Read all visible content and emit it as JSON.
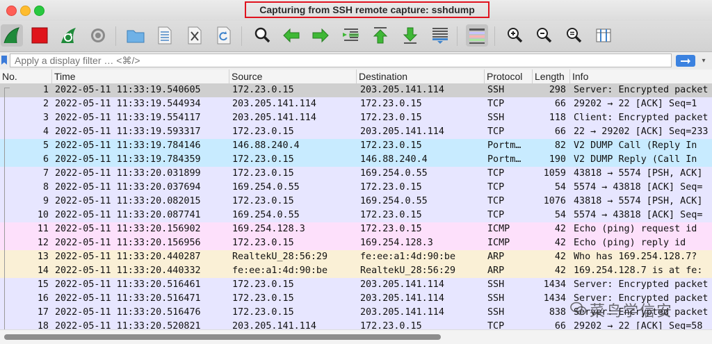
{
  "window": {
    "title": "Capturing from SSH remote capture: sshdump"
  },
  "toolbar": {
    "icons": [
      "shark-fin-start-icon",
      "stop-icon",
      "restart-capture-icon",
      "capture-options-gear-icon",
      "open-folder-icon",
      "save-file-icon",
      "close-file-icon",
      "reload-icon",
      "find-magnifier-icon",
      "go-back-arrow-icon",
      "go-forward-arrow-icon",
      "go-to-packet-icon",
      "go-first-packet-icon",
      "go-last-packet-icon",
      "autoscroll-icon",
      "colorize-icon",
      "zoom-in-icon",
      "zoom-out-icon",
      "normal-size-icon",
      "resize-columns-icon"
    ]
  },
  "filter": {
    "placeholder": "Apply a display filter … <⌘/>"
  },
  "columns": {
    "no": "No.",
    "time": "Time",
    "source": "Source",
    "destination": "Destination",
    "protocol": "Protocol",
    "length": "Length",
    "info": "Info"
  },
  "rows": [
    {
      "no": "1",
      "time": "2022-05-11 11:33:19.540605",
      "src": "172.23.0.15",
      "dst": "203.205.141.114",
      "prot": "SSH",
      "len": "298",
      "info": "Server: Encrypted packet",
      "color": "#cfcfcf"
    },
    {
      "no": "2",
      "time": "2022-05-11 11:33:19.544934",
      "src": "203.205.141.114",
      "dst": "172.23.0.15",
      "prot": "TCP",
      "len": "66",
      "info": "29202 → 22 [ACK] Seq=1",
      "color": "#e7e6ff"
    },
    {
      "no": "3",
      "time": "2022-05-11 11:33:19.554117",
      "src": "203.205.141.114",
      "dst": "172.23.0.15",
      "prot": "SSH",
      "len": "118",
      "info": "Client: Encrypted packet",
      "color": "#e7e6ff"
    },
    {
      "no": "4",
      "time": "2022-05-11 11:33:19.593317",
      "src": "172.23.0.15",
      "dst": "203.205.141.114",
      "prot": "TCP",
      "len": "66",
      "info": "22 → 29202 [ACK] Seq=233",
      "color": "#e7e6ff"
    },
    {
      "no": "5",
      "time": "2022-05-11 11:33:19.784146",
      "src": "146.88.240.4",
      "dst": "172.23.0.15",
      "prot": "Portm…",
      "len": "82",
      "info": "V2 DUMP Call (Reply In",
      "color": "#c8ebff"
    },
    {
      "no": "6",
      "time": "2022-05-11 11:33:19.784359",
      "src": "172.23.0.15",
      "dst": "146.88.240.4",
      "prot": "Portm…",
      "len": "190",
      "info": "V2 DUMP Reply (Call In",
      "color": "#c8ebff"
    },
    {
      "no": "7",
      "time": "2022-05-11 11:33:20.031899",
      "src": "172.23.0.15",
      "dst": "169.254.0.55",
      "prot": "TCP",
      "len": "1059",
      "info": "43818 → 5574 [PSH, ACK]",
      "color": "#e7e6ff"
    },
    {
      "no": "8",
      "time": "2022-05-11 11:33:20.037694",
      "src": "169.254.0.55",
      "dst": "172.23.0.15",
      "prot": "TCP",
      "len": "54",
      "info": "5574 → 43818 [ACK] Seq=",
      "color": "#e7e6ff"
    },
    {
      "no": "9",
      "time": "2022-05-11 11:33:20.082015",
      "src": "172.23.0.15",
      "dst": "169.254.0.55",
      "prot": "TCP",
      "len": "1076",
      "info": "43818 → 5574 [PSH, ACK]",
      "color": "#e7e6ff"
    },
    {
      "no": "10",
      "time": "2022-05-11 11:33:20.087741",
      "src": "169.254.0.55",
      "dst": "172.23.0.15",
      "prot": "TCP",
      "len": "54",
      "info": "5574 → 43818 [ACK] Seq=",
      "color": "#e7e6ff"
    },
    {
      "no": "11",
      "time": "2022-05-11 11:33:20.156902",
      "src": "169.254.128.3",
      "dst": "172.23.0.15",
      "prot": "ICMP",
      "len": "42",
      "info": "Echo (ping) request  id",
      "color": "#fde0fb"
    },
    {
      "no": "12",
      "time": "2022-05-11 11:33:20.156956",
      "src": "172.23.0.15",
      "dst": "169.254.128.3",
      "prot": "ICMP",
      "len": "42",
      "info": "Echo (ping) reply    id",
      "color": "#fde0fb"
    },
    {
      "no": "13",
      "time": "2022-05-11 11:33:20.440287",
      "src": "RealtekU_28:56:29",
      "dst": "fe:ee:a1:4d:90:be",
      "prot": "ARP",
      "len": "42",
      "info": "Who has 169.254.128.7?",
      "color": "#faf0d6"
    },
    {
      "no": "14",
      "time": "2022-05-11 11:33:20.440332",
      "src": "fe:ee:a1:4d:90:be",
      "dst": "RealtekU_28:56:29",
      "prot": "ARP",
      "len": "42",
      "info": "169.254.128.7 is at fe:",
      "color": "#faf0d6"
    },
    {
      "no": "15",
      "time": "2022-05-11 11:33:20.516461",
      "src": "172.23.0.15",
      "dst": "203.205.141.114",
      "prot": "SSH",
      "len": "1434",
      "info": "Server: Encrypted packet",
      "color": "#e7e6ff"
    },
    {
      "no": "16",
      "time": "2022-05-11 11:33:20.516471",
      "src": "172.23.0.15",
      "dst": "203.205.141.114",
      "prot": "SSH",
      "len": "1434",
      "info": "Server: Encrypted packet",
      "color": "#e7e6ff"
    },
    {
      "no": "17",
      "time": "2022-05-11 11:33:20.516476",
      "src": "172.23.0.15",
      "dst": "203.205.141.114",
      "prot": "SSH",
      "len": "838",
      "info": "Server: Encrypted packet",
      "color": "#e7e6ff"
    },
    {
      "no": "18",
      "time": "2022-05-11 11:33:20.520821",
      "src": "203.205.141.114",
      "dst": "172.23.0.15",
      "prot": "TCP",
      "len": "66",
      "info": "29202 → 22 [ACK] Seq=58",
      "color": "#e7e6ff"
    }
  ],
  "watermark": {
    "text": "菜鸟学信安"
  }
}
